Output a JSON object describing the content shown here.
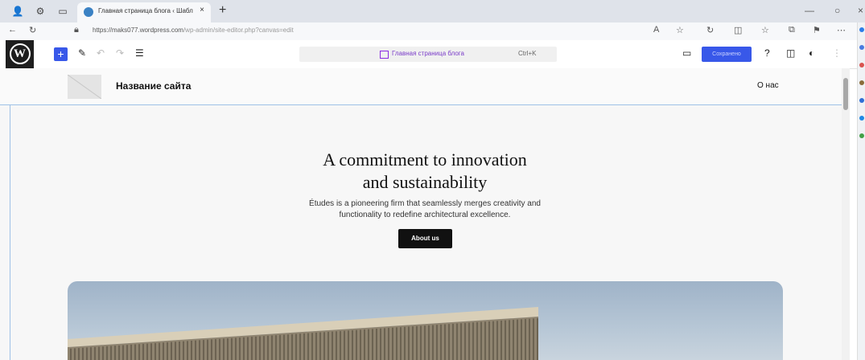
{
  "browser": {
    "tab_title": "Главная страница блога ‹ Шабл...",
    "tab_close": "×",
    "new_tab": "+",
    "url_main": "https://maks077.wordpress.com",
    "url_rest": "/wp-admin/site-editor.php?canvas=edit",
    "window_controls": [
      "—",
      "○",
      "×"
    ],
    "nav_icons": [
      "back-arrow-icon",
      "reload-icon",
      "lock-icon"
    ]
  },
  "wp_toolbar": {
    "command_title": "Главная страница блога",
    "command_shortcut": "Ctrl+K",
    "save_label": "Сохранено",
    "icons": [
      "wordpress-logo-icon",
      "plus-icon",
      "pen-icon",
      "undo-icon",
      "redo-icon",
      "list-view-icon",
      "desktop-preview-icon",
      "help-icon",
      "sidebar-icon",
      "styles-icon",
      "more-icon"
    ]
  },
  "site_header": {
    "site_name": "Название сайта",
    "nav_link": "О нас"
  },
  "hero": {
    "title_line1": "A commitment to innovation",
    "title_line2": "and sustainability",
    "text_line1": "Études is a pioneering firm that seamlessly merges creativity and",
    "text_line2": "functionality to redefine architectural excellence.",
    "button_label": "About us"
  },
  "colors": {
    "wp_blue": "#3858e9",
    "selection_outline": "#9ec1e6",
    "command_purple": "#7a3cc9"
  }
}
